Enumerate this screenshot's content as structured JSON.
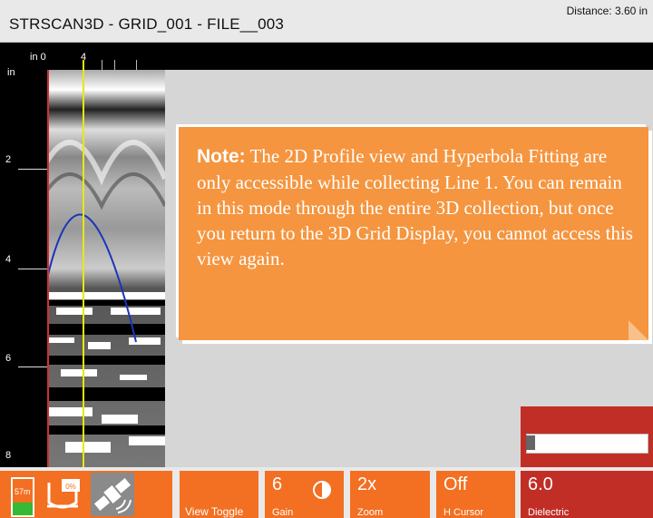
{
  "header": {
    "title": "STRSCAN3D - GRID_001 - FILE__003",
    "distance": "Distance: 3.60 in"
  },
  "scale": {
    "unit_top": "in",
    "top_start": "0",
    "top_4": "4",
    "unit_side": "in",
    "depth_labels": [
      "2",
      "4",
      "6",
      "8"
    ]
  },
  "note": {
    "heading": "Note:",
    "body": " The 2D Profile view and Hyperbola Fitting are only accessible while collecting Line 1. You can remain in this mode through the entire 3D collection, but once you return to the 3D Grid Display, you cannot access this view again."
  },
  "status": {
    "battery_text": "57m",
    "battery_level": 0.35,
    "disk_text": "0%",
    "gps_icon": "satellite-icon"
  },
  "toolbar": {
    "view_toggle_label": "View Toggle",
    "gain_value": "6",
    "gain_label": "Gain",
    "contrast_icon": "contrast-icon",
    "zoom_value": "2x",
    "zoom_label": "Zoom",
    "hcursor_value": "Off",
    "hcursor_label": "H Cursor",
    "dielectric_value": "6.0",
    "dielectric_label": "Dielectric"
  },
  "colors": {
    "accent": "#f36f21",
    "note_bg": "#f5953f",
    "dielectric_bg": "#c12e26",
    "cursor": "#e8e800",
    "hyperbola": "#1a35b8"
  }
}
